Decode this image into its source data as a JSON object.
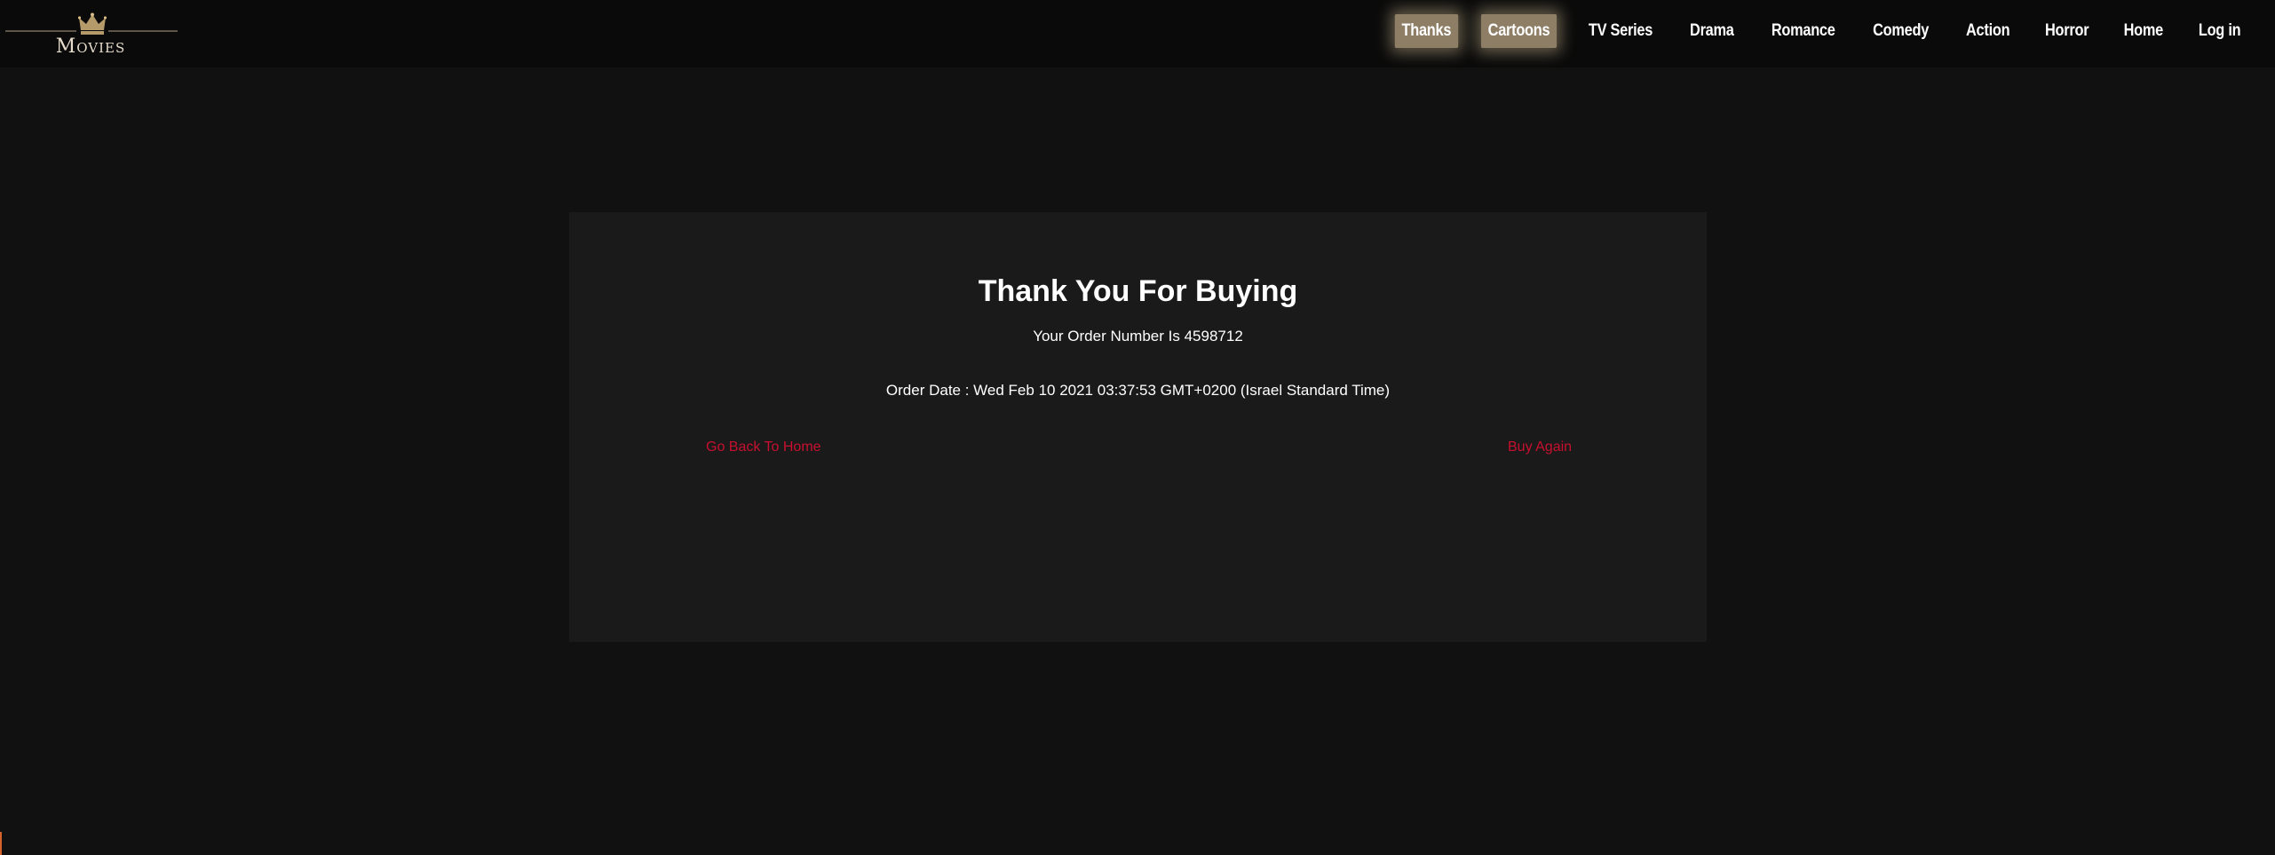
{
  "logo": {
    "text": "Movies",
    "icon": "crown-icon"
  },
  "nav": {
    "items": [
      {
        "label": "Thanks",
        "active": true
      },
      {
        "label": "Cartoons",
        "active": true
      },
      {
        "label": "TV Series",
        "active": false
      },
      {
        "label": "Drama",
        "active": false
      },
      {
        "label": "Romance",
        "active": false
      },
      {
        "label": "Comedy",
        "active": false
      },
      {
        "label": "Action",
        "active": false
      },
      {
        "label": "Horror",
        "active": false
      },
      {
        "label": "Home",
        "active": false
      },
      {
        "label": "Log in",
        "active": false
      }
    ]
  },
  "card": {
    "title": "Thank You For Buying",
    "order_number_text": "Your Order Number Is 4598712",
    "order_date_text": "Order Date : Wed Feb 10 2021 03:37:53 GMT+0200 (Israel Standard Time)",
    "back_home_label": "Go Back To Home",
    "buy_again_label": "Buy Again"
  },
  "colors": {
    "background": "#111111",
    "header": "#0a0a0a",
    "card": "#1a1a1a",
    "link": "#c8102e",
    "nav_active": "#8e7e66",
    "logo_text": "#e6dccb"
  }
}
